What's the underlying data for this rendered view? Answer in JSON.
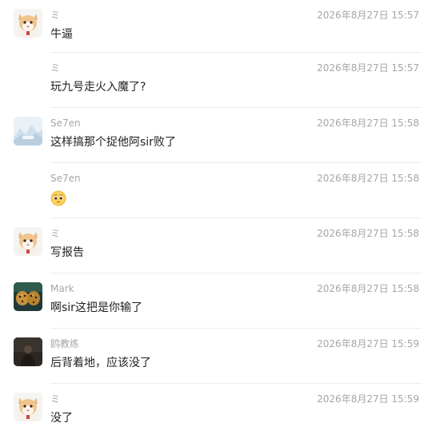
{
  "messages": [
    {
      "avatar": "cat-avatar-icon",
      "name": "ミ",
      "time": "2026年8月27日 15:57",
      "text": "牛逼"
    },
    {
      "avatar": "",
      "name": "ミ",
      "time": "2026年8月27日 15:57",
      "text": "玩九号走火入魔了?"
    },
    {
      "avatar": "landscape-avatar-icon",
      "name": "Se7en",
      "time": "2026年8月27日 15:58",
      "text": "这样搞那个捉他阿sir败了"
    },
    {
      "avatar": "",
      "name": "Se7en",
      "time": "2026年8月27日 15:58",
      "text": "",
      "emoji": "pleading-face-icon"
    },
    {
      "avatar": "cat-avatar-icon",
      "name": "ミ",
      "time": "2026年8月27日 15:58",
      "text": "写报告"
    },
    {
      "avatar": "jaguar-avatar-icon",
      "name": "Mark",
      "time": "2026年8月27日 15:58",
      "text": "啊sir这把是你输了"
    },
    {
      "avatar": "dark-avatar-icon",
      "name": "鸥教练",
      "time": "2026年8月27日 15:59",
      "text": "后背着地，应该没了"
    },
    {
      "avatar": "cat-avatar-icon",
      "name": "ミ",
      "time": "2026年8月27日 15:59",
      "text": "没了"
    }
  ]
}
